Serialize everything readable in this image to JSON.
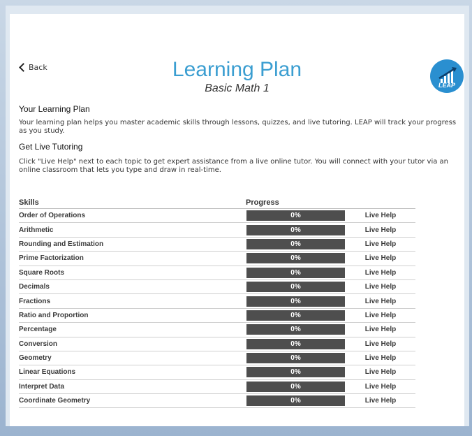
{
  "header": {
    "back_label": "Back",
    "title": "Learning Plan",
    "subtitle": "Basic Math 1",
    "logo_text": "LEAP"
  },
  "sections": {
    "plan_heading": "Your Learning Plan",
    "plan_text": "Your learning plan helps you master academic skills through lessons, quizzes, and live tutoring. LEAP will track your progress as you study.",
    "tutoring_heading": "Get Live Tutoring",
    "tutoring_text": "Click \"Live Help\" next to each topic to get expert assistance from a live online tutor. You will connect with your tutor via an online classroom that lets you type and draw in real-time."
  },
  "table": {
    "col_skills": "Skills",
    "col_progress": "Progress",
    "rows": [
      {
        "skill": "Order of Operations",
        "progress": 0,
        "progress_label": "0%",
        "help": "Live Help"
      },
      {
        "skill": "Arithmetic",
        "progress": 0,
        "progress_label": "0%",
        "help": "Live Help"
      },
      {
        "skill": "Rounding and Estimation",
        "progress": 0,
        "progress_label": "0%",
        "help": "Live Help"
      },
      {
        "skill": "Prime Factorization",
        "progress": 0,
        "progress_label": "0%",
        "help": "Live Help"
      },
      {
        "skill": "Square Roots",
        "progress": 0,
        "progress_label": "0%",
        "help": "Live Help"
      },
      {
        "skill": "Decimals",
        "progress": 0,
        "progress_label": "0%",
        "help": "Live Help"
      },
      {
        "skill": "Fractions",
        "progress": 0,
        "progress_label": "0%",
        "help": "Live Help"
      },
      {
        "skill": "Ratio and Proportion",
        "progress": 0,
        "progress_label": "0%",
        "help": "Live Help"
      },
      {
        "skill": "Percentage",
        "progress": 0,
        "progress_label": "0%",
        "help": "Live Help"
      },
      {
        "skill": "Conversion",
        "progress": 0,
        "progress_label": "0%",
        "help": "Live Help"
      },
      {
        "skill": "Geometry",
        "progress": 0,
        "progress_label": "0%",
        "help": "Live Help"
      },
      {
        "skill": "Linear Equations",
        "progress": 0,
        "progress_label": "0%",
        "help": "Live Help"
      },
      {
        "skill": "Interpret Data",
        "progress": 0,
        "progress_label": "0%",
        "help": "Live Help"
      },
      {
        "skill": "Coordinate Geometry",
        "progress": 0,
        "progress_label": "0%",
        "help": "Live Help"
      }
    ]
  },
  "colors": {
    "title": "#3b9ed1",
    "progress_track": "#4e4e4e",
    "progress_fill": "#2a8fd0",
    "logo_bg": "#2a8fd0"
  },
  "icons": {
    "back": "chevron-left-icon",
    "logo": "bar-chart-arrow-icon"
  }
}
